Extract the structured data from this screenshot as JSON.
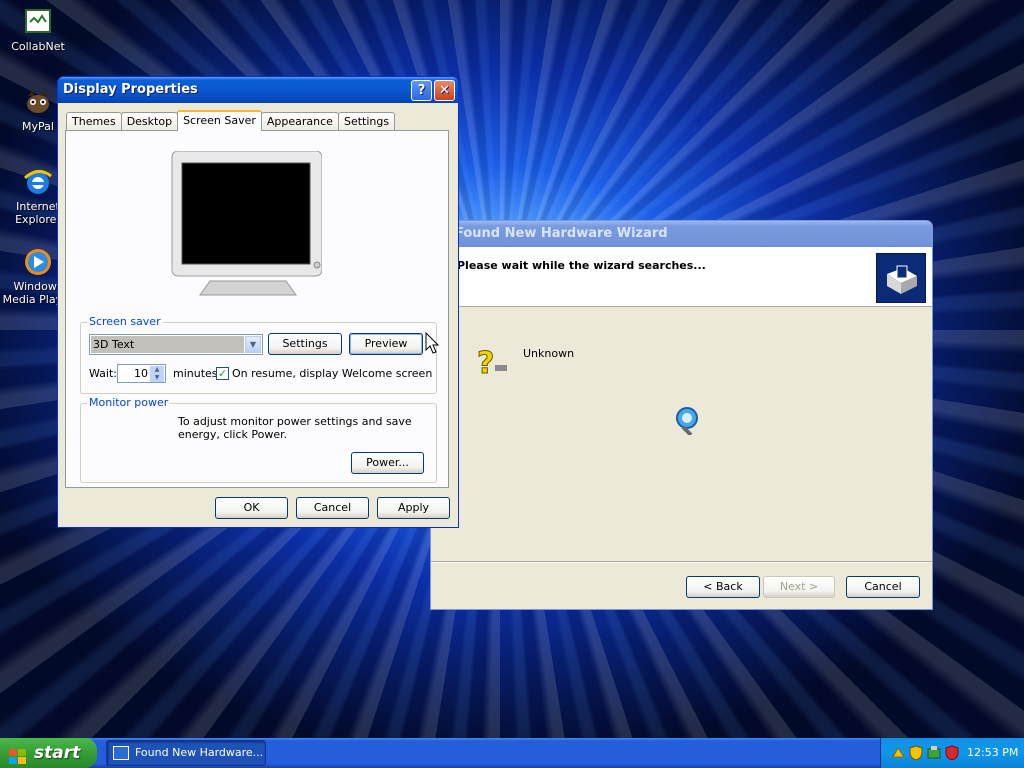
{
  "desktop": {
    "icons": [
      {
        "label": "CollabNet",
        "icon": "collabnet-icon"
      },
      {
        "label": "MyPal",
        "icon": "mypal-icon"
      },
      {
        "label": "Internet Explorer",
        "icon": "internet-explorer-icon"
      },
      {
        "label": "Windows Media Player",
        "icon": "media-player-icon"
      }
    ]
  },
  "display_properties": {
    "title": "Display Properties",
    "help": "?",
    "close": "✕",
    "tabs": [
      "Themes",
      "Desktop",
      "Screen Saver",
      "Appearance",
      "Settings"
    ],
    "active_tab": "Screen Saver",
    "screen_saver": {
      "group_title": "Screen saver",
      "selected": "3D Text",
      "settings_label": "Settings",
      "preview_label": "Preview",
      "wait_label": "Wait:",
      "wait_value": "10",
      "minutes_label": "minutes",
      "resume_checked": true,
      "resume_label": "On resume, display Welcome screen"
    },
    "monitor_power": {
      "group_title": "Monitor power",
      "text": "To adjust monitor power settings and save energy, click Power.",
      "power_label": "Power..."
    },
    "ok_label": "OK",
    "cancel_label": "Cancel",
    "apply_label": "Apply"
  },
  "wizard": {
    "title": "Found New Hardware Wizard",
    "heading": "Please wait while the wizard searches...",
    "device_name": "Unknown",
    "back_label": "< Back",
    "next_label": "Next >",
    "cancel_label": "Cancel"
  },
  "taskbar": {
    "start_label": "start",
    "task_label": "Found New Hardware...",
    "clock": "12:53 PM"
  }
}
